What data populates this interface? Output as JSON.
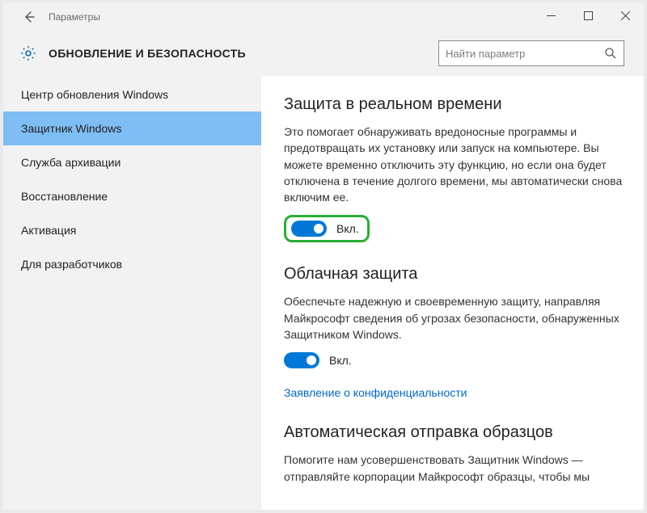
{
  "window": {
    "title": "Параметры"
  },
  "header": {
    "title": "ОБНОВЛЕНИЕ И БЕЗОПАСНОСТЬ"
  },
  "search": {
    "placeholder": "Найти параметр"
  },
  "sidebar": {
    "items": [
      {
        "label": "Центр обновления Windows"
      },
      {
        "label": "Защитник Windows"
      },
      {
        "label": "Служба архивации"
      },
      {
        "label": "Восстановление"
      },
      {
        "label": "Активация"
      },
      {
        "label": "Для разработчиков"
      }
    ]
  },
  "sections": {
    "realtime": {
      "title": "Защита в реальном времени",
      "desc": "Это помогает обнаруживать вредоносные программы и предотвращать их установку или запуск на компьютере. Вы можете временно отключить эту функцию, но если она будет отключена в течение долгого времени, мы автоматически снова включим ее.",
      "state": "Вкл."
    },
    "cloud": {
      "title": "Облачная защита",
      "desc": "Обеспечьте надежную и своевременную защиту, направляя Майкрософт сведения об угрозах безопасности, обнаруженных Защитником Windows.",
      "state": "Вкл.",
      "link": "Заявление о конфиденциальности"
    },
    "samples": {
      "title": "Автоматическая отправка образцов",
      "desc": "Помогите нам усовершенствовать Защитник Windows — отправляйте корпорации Майкрософт образцы, чтобы мы"
    }
  }
}
